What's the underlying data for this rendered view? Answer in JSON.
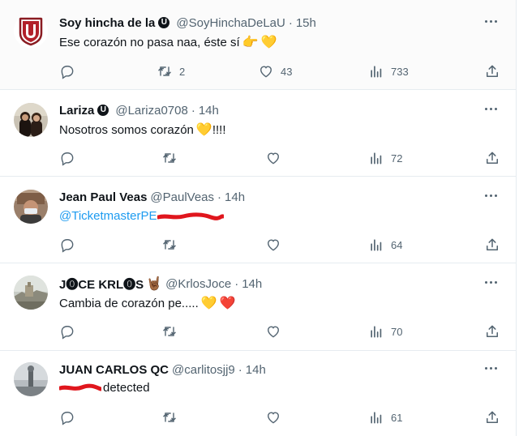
{
  "colors": {
    "accent": "#1d9bf0",
    "muted": "#536471",
    "text": "#0f1419",
    "redaction": "#e0161d",
    "heart_yellow": "#fcc22d",
    "heart_red": "#e0161d"
  },
  "tweets": [
    {
      "name": "Soy hincha de la",
      "badge": "U",
      "handle": "@SoyHinchaDeLaU",
      "dot": "·",
      "time": "15h",
      "text": "Ese corazón no pasa naa, éste sí",
      "emojis": [
        "👉",
        "💛"
      ],
      "replies": "",
      "retweets": "2",
      "likes": "43",
      "views": "733"
    },
    {
      "name": "Lariza",
      "badge": "U",
      "handle": "@Lariza0708",
      "dot": "·",
      "time": "14h",
      "text": "Nosotros somos corazón",
      "text_after": "!!!!",
      "emojis": [
        "💛"
      ],
      "replies": "",
      "retweets": "",
      "likes": "",
      "views": "72"
    },
    {
      "name": "Jean Paul Veas",
      "handle": "@PaulVeas",
      "dot": "·",
      "time": "14h",
      "mention": "@TicketmasterPE",
      "replies": "",
      "retweets": "",
      "likes": "",
      "views": "64"
    },
    {
      "name": "J⓿CE KRL⓿S",
      "emojis_name": [
        "🤘🏾"
      ],
      "handle": "@KrlosJoce",
      "dot": "·",
      "time": "14h",
      "text": "Cambia de corazón pe.....",
      "emojis": [
        "💛",
        "❤️"
      ],
      "replies": "",
      "retweets": "",
      "likes": "",
      "views": "70"
    },
    {
      "name": "JUAN CARLOS QC",
      "handle": "@carlitosjj9",
      "dot": "·",
      "time": "14h",
      "text": "detected",
      "replies": "",
      "retweets": "",
      "likes": "",
      "views": "61"
    }
  ],
  "icons": {
    "reply": "reply-icon",
    "retweet": "retweet-icon",
    "like": "heart-icon",
    "views": "views-icon",
    "share": "share-icon",
    "more": "more-icon"
  }
}
